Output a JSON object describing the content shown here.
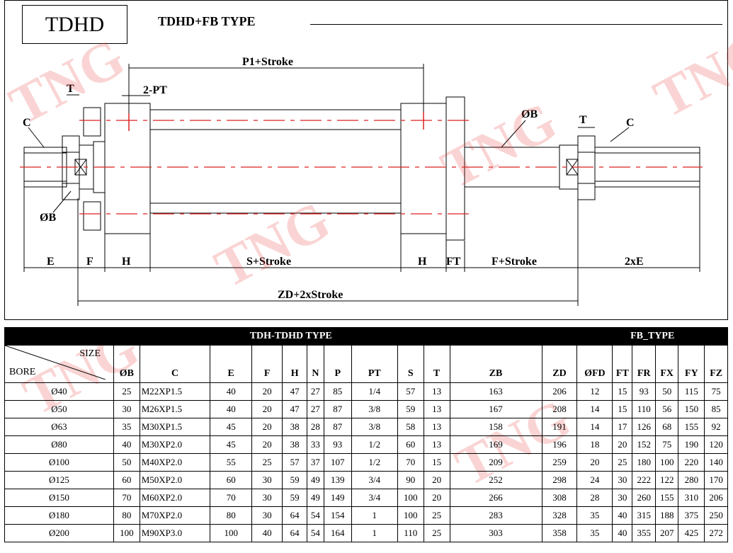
{
  "header": {
    "model_label": "TDHD",
    "type_title": "TDHD+FB  TYPE"
  },
  "drawing": {
    "labels": {
      "p1_stroke": "P1+Stroke",
      "t_left": "T",
      "two_pt": "2-PT",
      "c_left": "C",
      "phi_b_left": "ØB",
      "phi_b_right": "ØB",
      "t_right": "T",
      "c_right": "C",
      "e": "E",
      "f": "F",
      "h_left": "H",
      "s_stroke": "S+Stroke",
      "h_right": "H",
      "ft": "FT",
      "f_stroke": "F+Stroke",
      "two_e": "2xE",
      "zd_stroke": "ZD+2xStroke"
    }
  },
  "watermark": {
    "text": "TNG"
  },
  "table": {
    "band_left": "TDH-TDHD TYPE",
    "band_right": "FB_TYPE",
    "corner_size": "SIZE",
    "corner_bore": "BORE",
    "columns": [
      "ØB",
      "C",
      "E",
      "F",
      "H",
      "N",
      "P",
      "PT",
      "S",
      "T",
      "ZB",
      "ZD",
      "ØFD",
      "FT",
      "FR",
      "FX",
      "FY",
      "FZ"
    ],
    "rows": [
      [
        "Ø40",
        "25",
        "M22XP1.5",
        "40",
        "20",
        "47",
        "27",
        "85",
        "1/4",
        "57",
        "13",
        "163",
        "206",
        "12",
        "15",
        "93",
        "50",
        "115",
        "75"
      ],
      [
        "Ø50",
        "30",
        "M26XP1.5",
        "40",
        "20",
        "47",
        "27",
        "87",
        "3/8",
        "59",
        "13",
        "167",
        "208",
        "14",
        "15",
        "110",
        "56",
        "150",
        "85"
      ],
      [
        "Ø63",
        "35",
        "M30XP1.5",
        "45",
        "20",
        "38",
        "28",
        "87",
        "3/8",
        "58",
        "13",
        "158",
        "191",
        "14",
        "17",
        "126",
        "68",
        "155",
        "92"
      ],
      [
        "Ø80",
        "40",
        "M30XP2.0",
        "45",
        "20",
        "38",
        "33",
        "93",
        "1/2",
        "60",
        "13",
        "169",
        "196",
        "18",
        "20",
        "152",
        "75",
        "190",
        "120"
      ],
      [
        "Ø100",
        "50",
        "M40XP2.0",
        "55",
        "25",
        "57",
        "37",
        "107",
        "1/2",
        "70",
        "15",
        "209",
        "259",
        "20",
        "25",
        "180",
        "100",
        "220",
        "140"
      ],
      [
        "Ø125",
        "60",
        "M50XP2.0",
        "60",
        "30",
        "59",
        "49",
        "139",
        "3/4",
        "90",
        "20",
        "252",
        "298",
        "24",
        "30",
        "222",
        "122",
        "280",
        "170"
      ],
      [
        "Ø150",
        "70",
        "M60XP2.0",
        "70",
        "30",
        "59",
        "49",
        "149",
        "3/4",
        "100",
        "20",
        "266",
        "308",
        "28",
        "30",
        "260",
        "155",
        "310",
        "206"
      ],
      [
        "Ø180",
        "80",
        "M70XP2.0",
        "80",
        "30",
        "64",
        "54",
        "154",
        "1",
        "100",
        "25",
        "283",
        "328",
        "35",
        "40",
        "315",
        "188",
        "375",
        "250"
      ],
      [
        "Ø200",
        "100",
        "M90XP3.0",
        "100",
        "40",
        "64",
        "54",
        "164",
        "1",
        "110",
        "25",
        "303",
        "358",
        "35",
        "40",
        "355",
        "207",
        "425",
        "272"
      ]
    ]
  }
}
